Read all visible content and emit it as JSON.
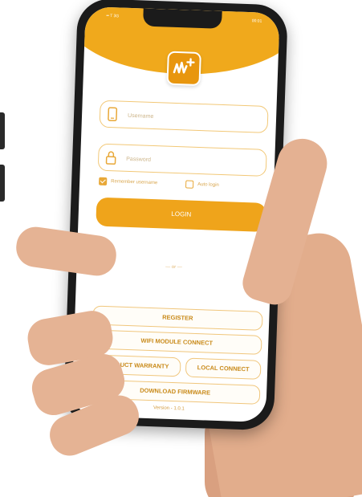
{
  "status_bar": {
    "left": "•• T 3G",
    "right": "00:01"
  },
  "login_form": {
    "username_placeholder": "Username",
    "password_placeholder": "Password",
    "remember_label": "Remember username",
    "remember_checked": true,
    "auto_login_label": "Auto login",
    "auto_login_checked": false,
    "login_label": "LOGIN"
  },
  "divider": {
    "label": "— or —"
  },
  "actions": {
    "register": "REGISTER",
    "wifi_module_connect": "WIFI MODULE CONNECT",
    "product_warranty": "PRODUCT WARRANTY",
    "local_connect": "LOCAL CONNECT",
    "download_firmware": "DOWNLOAD FIRMWARE"
  },
  "version": "Version - 1.0.1",
  "colors": {
    "accent": "#f0a91c",
    "accent_light": "#f2c877",
    "label": "#c98a19"
  },
  "icons": [
    "app-logo-icon",
    "phone-icon",
    "lock-icon",
    "checkbox-check-icon"
  ]
}
